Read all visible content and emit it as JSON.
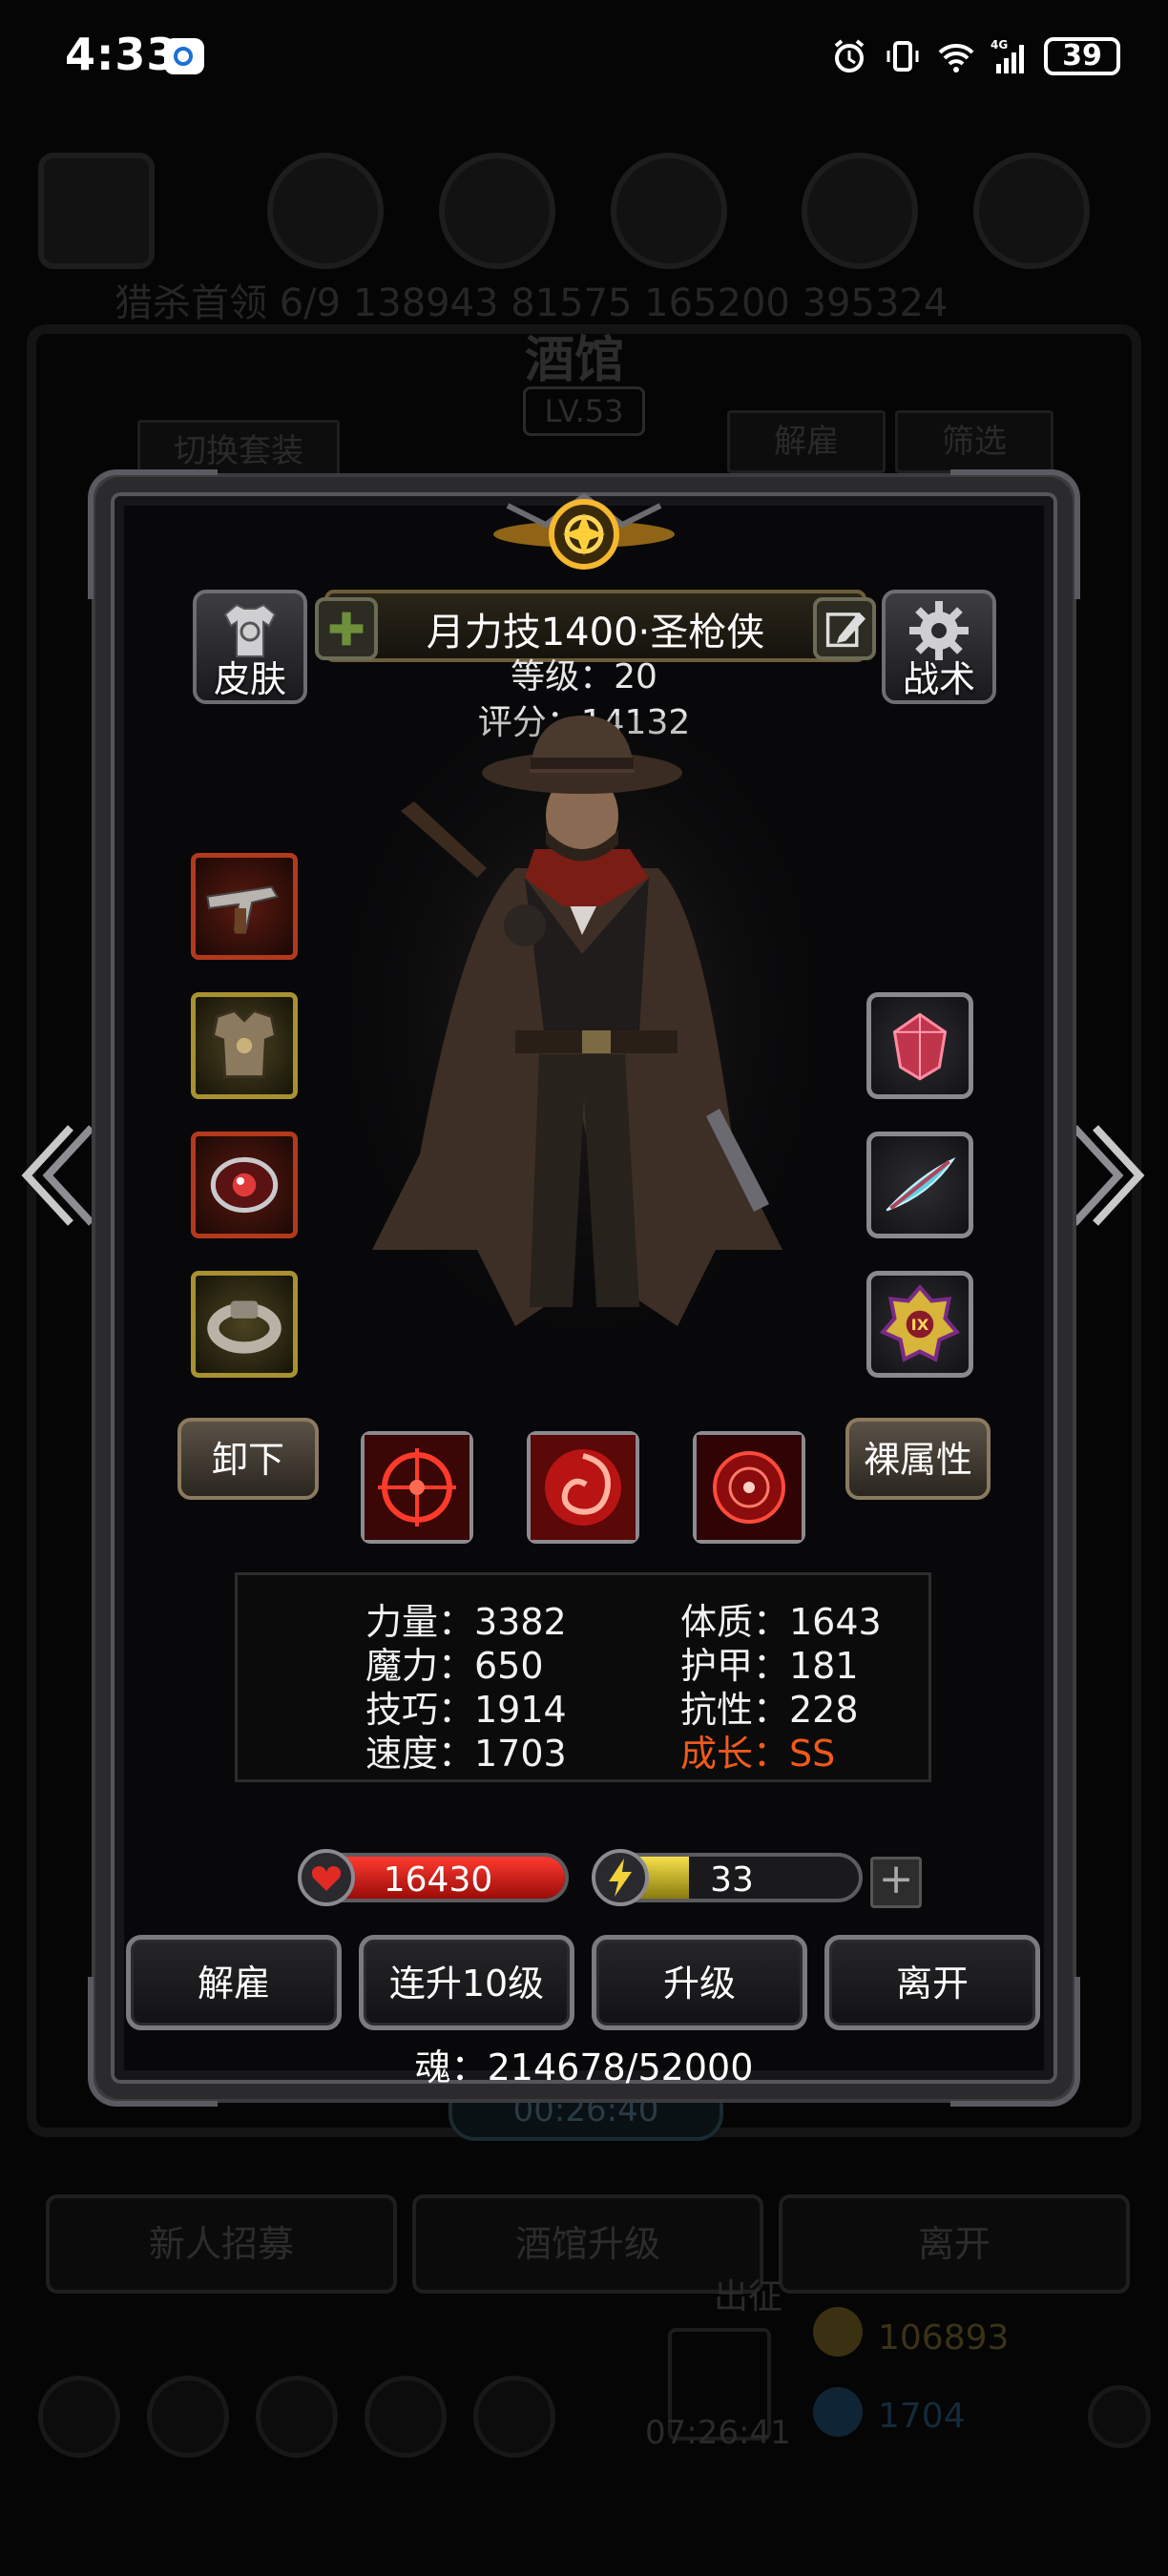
{
  "status_bar": {
    "time": "4:33",
    "battery": "39",
    "icons": [
      "alarm-icon",
      "vibrate-icon",
      "wifi-icon",
      "signal-4g-icon",
      "battery-icon"
    ]
  },
  "background": {
    "info_line": "猎杀首领 6/9   138943   81575   165200   395324",
    "title": "酒馆",
    "level": "LV.53",
    "tabs": {
      "switch_outfit": "切换套装",
      "dismiss": "解雇",
      "filter": "筛选"
    },
    "timer": "00:26:40",
    "buttons": {
      "recruit": "新人招募",
      "upgrade": "酒馆升级",
      "leave": "离开"
    },
    "march": "出征",
    "gift_timer": "07:26:41",
    "gold": "106893",
    "gems": "1704"
  },
  "hero": {
    "skin_label": "皮肤",
    "tactics_label": "战术",
    "name": "月力技1400·圣枪侠",
    "level": "等级：20",
    "score": "评分：14132"
  },
  "equipment": {
    "left": [
      "pistol-icon",
      "armor-icon",
      "amulet-icon",
      "ring-icon"
    ],
    "right": [
      "ruby-gem-icon",
      "feather-icon",
      "crest-badge-icon"
    ]
  },
  "actions": {
    "unequip": "卸下",
    "base_attrs": "裸属性"
  },
  "skills": [
    "crosshair-skill-icon",
    "vortex-skill-icon",
    "target-skill-icon"
  ],
  "stats": {
    "strength": "力量：3382",
    "constitution": "体质：1643",
    "magic": "魔力：650",
    "armor": "护甲：181",
    "skill": "技巧：1914",
    "resistance": "抗性：228",
    "speed": "速度：1703",
    "growth": "成长：SS"
  },
  "bars": {
    "hp": "16430",
    "hp_fill": 1.0,
    "energy": "33",
    "energy_fill": 0.33
  },
  "buttons": {
    "dismiss": "解雇",
    "level10": "连升10级",
    "upgrade": "升级",
    "leave": "离开"
  },
  "soul": "魂：214678/52000",
  "colors": {
    "growth": "#ef5a1a",
    "hp": "#e0201a",
    "energy": "#e6d23a"
  }
}
